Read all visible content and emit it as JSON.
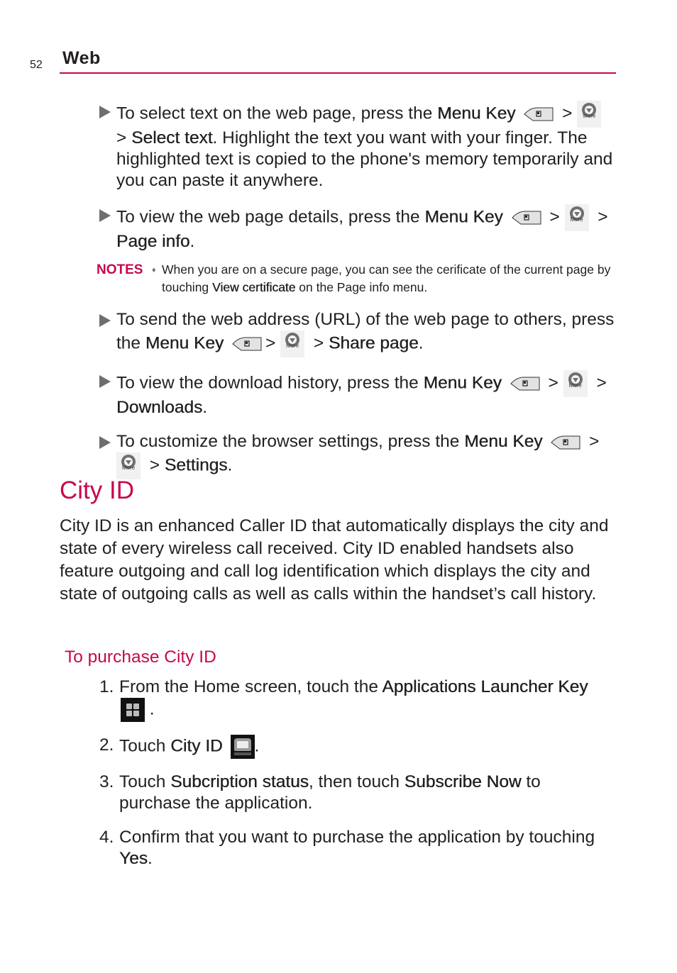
{
  "header": {
    "page_number": "52",
    "section": "Web"
  },
  "bullets": [
    {
      "pre": "To select text on the web page, press the ",
      "key": "Menu Key",
      "mid": " > ",
      "post_pre": " > ",
      "target": "Select text",
      "post": ". Highlight the text you want with your finger. The highlighted text is copied to the phone's memory temporarily and you can paste it anywhere."
    },
    {
      "pre": "To view the web page details, press the ",
      "key": "Menu Key",
      "mid": " > ",
      "post_pre": " > ",
      "target": "Page info",
      "post": "."
    },
    {
      "pre": "To send the web address (URL) of the web page to others, press the ",
      "key": "Menu Key",
      "mid": "> ",
      "post_pre": " > ",
      "target": "Share page",
      "post": "."
    },
    {
      "pre": "To view the download history, press the ",
      "key": "Menu Key",
      "mid": " > ",
      "post_pre": " > ",
      "target": "Downloads",
      "post": "."
    },
    {
      "pre": "To customize the browser settings, press the ",
      "key": "Menu Key",
      "mid": " > ",
      "post_pre": " > ",
      "target": "Settings",
      "post": "."
    }
  ],
  "icons": {
    "more_label": "More"
  },
  "notes": {
    "tag": "NOTES",
    "pre": "When you are on a secure page, you can see the cerificate of the current page by touching ",
    "bold": "View certificate",
    "post": " on the Page info menu."
  },
  "city_id": {
    "title": "City ID",
    "intro": "City ID is an enhanced Caller ID that automatically displays the city and state of every wireless call received. City ID enabled handsets also feature outgoing and call log identification which displays the city and state of outgoing calls as well as calls within the handset’s call history.",
    "subtitle": "To purchase City ID",
    "steps": [
      {
        "num": "1.",
        "pre": "From the Home screen, touch the ",
        "bold": "Applications Launcher Key",
        "post": " ."
      },
      {
        "num": "2.",
        "pre": "Touch ",
        "bold": "City ID",
        "post": "."
      },
      {
        "num": "3.",
        "pre": "Touch ",
        "bold": "Subcription status",
        "mid": ", then touch ",
        "bold2": "Subscribe Now",
        "post": " to purchase the application."
      },
      {
        "num": "4.",
        "pre": "Confirm that you want to purchase the application by touching ",
        "bold": "Yes",
        "post": "."
      }
    ]
  },
  "colors": {
    "accent": "#c6084f",
    "text": "#231f20",
    "bullet_arrow": "#6d6e71"
  }
}
